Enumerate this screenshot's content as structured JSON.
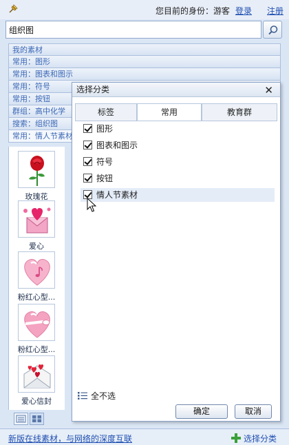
{
  "topbar": {
    "identity": "您目前的身份：游客",
    "login": "登录",
    "register": "注册"
  },
  "search": {
    "value": "组织图"
  },
  "categories": [
    "我的素材",
    "常用：图形",
    "常用：图表和图示",
    "常用：符号",
    "常用：按钮",
    "群组：高中化学",
    "搜索：组织图",
    "常用：情人节素材"
  ],
  "thumbnails": [
    {
      "icon": "rose-icon",
      "label": "玫瑰花"
    },
    {
      "icon": "love-heart-envelope-icon",
      "label": "爱心"
    },
    {
      "icon": "pink-heart-music-icon",
      "label": "粉红心型..."
    },
    {
      "icon": "pink-heart-ribbon-icon",
      "label": "粉红心型..."
    },
    {
      "icon": "love-letter-icon",
      "label": "爱心信封"
    }
  ],
  "footer": {
    "link": "新版在线素材，与网络的深度互联",
    "select_category": "选择分类"
  },
  "dialog": {
    "title": "选择分类",
    "tabs": [
      "标签",
      "常用",
      "教育群"
    ],
    "active_tab": "常用",
    "options": [
      {
        "label": "图形",
        "checked": true
      },
      {
        "label": "图表和图示",
        "checked": true
      },
      {
        "label": "符号",
        "checked": true
      },
      {
        "label": "按钮",
        "checked": true
      },
      {
        "label": "情人节素材",
        "checked": true
      }
    ],
    "deselect_all": "全不选",
    "ok": "确定",
    "cancel": "取消"
  },
  "colors": {
    "link": "#1f4fb0",
    "category_text": "#3c68b6",
    "border": "#a9bedd"
  }
}
